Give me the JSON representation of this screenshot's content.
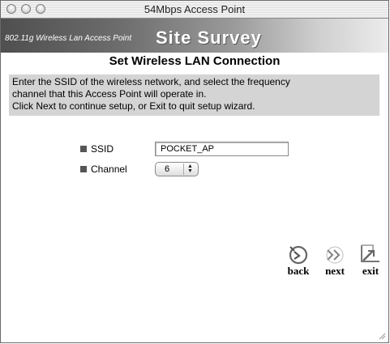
{
  "window": {
    "title": "54Mbps Access Point"
  },
  "banner": {
    "subtitle": "802.11g Wireless Lan Access Point",
    "title": "Site Survey"
  },
  "page": {
    "heading": "Set Wireless LAN Connection",
    "instructions": [
      "Enter the SSID of the wireless network, and select the frequency",
      "channel that this Access Point will operate in.",
      "Click Next to continue setup, or Exit to quit setup wizard."
    ]
  },
  "form": {
    "ssid_label": "SSID",
    "ssid_value": "POCKET_AP",
    "channel_label": "Channel",
    "channel_value": "6"
  },
  "nav": {
    "back_label": "back",
    "next_label": "next",
    "exit_label": "exit"
  },
  "icons": {
    "close": "close-light",
    "minimize": "minimize-light",
    "zoom": "zoom-light",
    "back": "back-icon",
    "next": "next-icon",
    "exit": "exit-icon"
  }
}
